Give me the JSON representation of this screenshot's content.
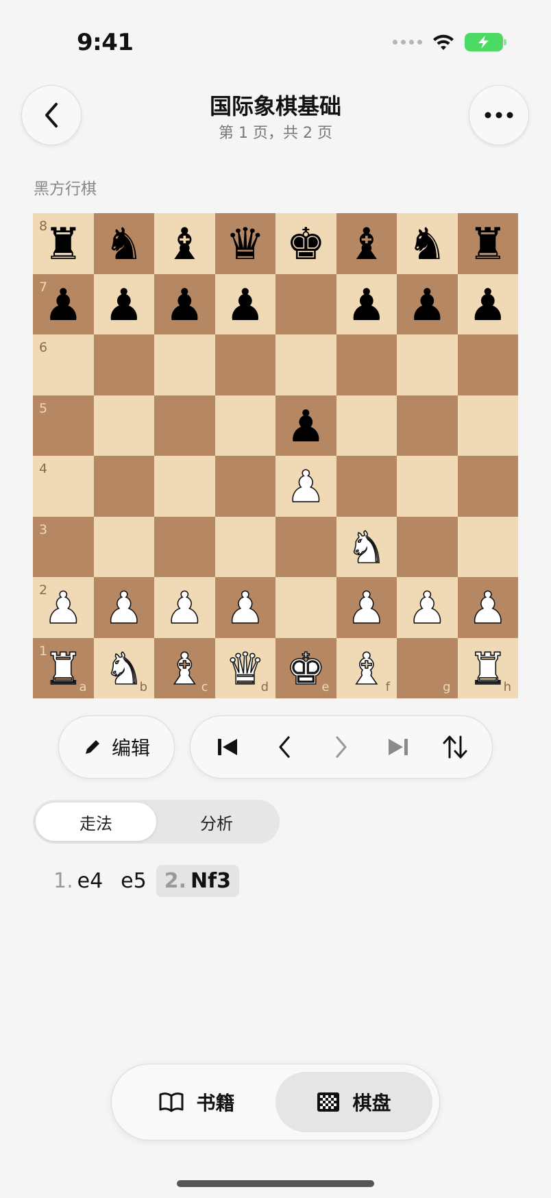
{
  "status": {
    "time": "9:41"
  },
  "header": {
    "title": "国际象棋基础",
    "subtitle": "第 1 页，共 2 页"
  },
  "turn_label": "黑方行棋",
  "board": {
    "light_color": "#f0d9b5",
    "dark_color": "#b58863",
    "ranks": [
      "8",
      "7",
      "6",
      "5",
      "4",
      "3",
      "2",
      "1"
    ],
    "files": [
      "a",
      "b",
      "c",
      "d",
      "e",
      "f",
      "g",
      "h"
    ],
    "rows": [
      [
        "r",
        "n",
        "b",
        "q",
        "k",
        "b",
        "n",
        "r"
      ],
      [
        "p",
        "p",
        "p",
        "p",
        "",
        "p",
        "p",
        "p"
      ],
      [
        "",
        "",
        "",
        "",
        "",
        "",
        "",
        ""
      ],
      [
        "",
        "",
        "",
        "",
        "p",
        "",
        "",
        ""
      ],
      [
        "",
        "",
        "",
        "",
        "P",
        "",
        "",
        ""
      ],
      [
        "",
        "",
        "",
        "",
        "",
        "N",
        "",
        ""
      ],
      [
        "P",
        "P",
        "P",
        "P",
        "",
        "P",
        "P",
        "P"
      ],
      [
        "R",
        "N",
        "B",
        "Q",
        "K",
        "B",
        "",
        "R"
      ]
    ]
  },
  "controls": {
    "edit_label": "编辑"
  },
  "segmented": {
    "moves_label": "走法",
    "analysis_label": "分析"
  },
  "moves": [
    {
      "num": "1.",
      "san": "e4",
      "current": false
    },
    {
      "num": "",
      "san": "e5",
      "current": false
    },
    {
      "num": "2.",
      "san": "Nf3",
      "current": true
    }
  ],
  "tabbar": {
    "books_label": "书籍",
    "board_label": "棋盘"
  },
  "colors": {
    "battery": "#4cd964",
    "accent": "#111111"
  }
}
